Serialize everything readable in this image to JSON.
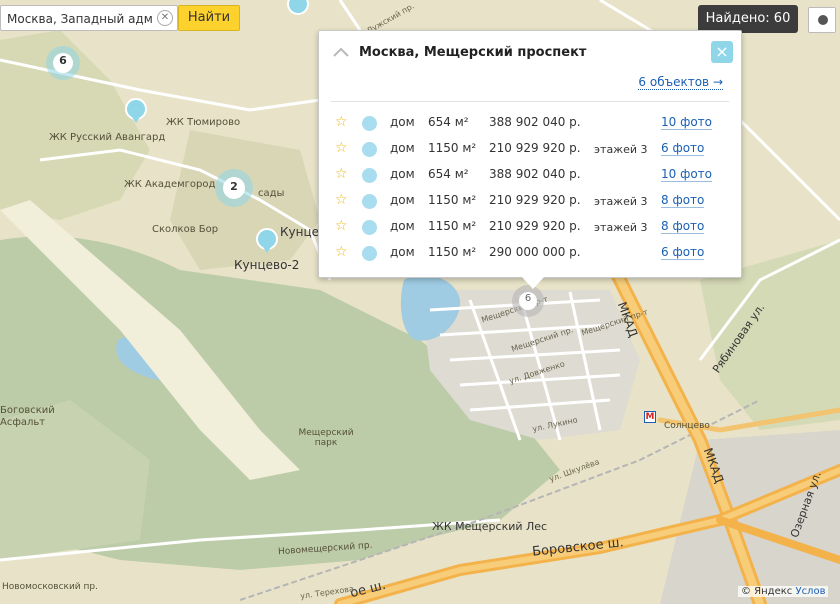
{
  "search": {
    "value": "Москва, Западный адм",
    "clear_icon": "close-icon",
    "button_label": "Найти"
  },
  "found_badge": "Найдено: 60",
  "popup": {
    "title": "Москва, Мещерский проспект",
    "objects_link": "6 объектов →",
    "rows": [
      {
        "type": "дом",
        "area": "654 м²",
        "price": "388 902 040 р.",
        "floors": "",
        "photos": "10 фото"
      },
      {
        "type": "дом",
        "area": "1150 м²",
        "price": "210 929 920 р.",
        "floors": "этажей 3",
        "photos": "6 фото"
      },
      {
        "type": "дом",
        "area": "654 м²",
        "price": "388 902 040 р.",
        "floors": "",
        "photos": "10 фото"
      },
      {
        "type": "дом",
        "area": "1150 м²",
        "price": "210 929 920 р.",
        "floors": "этажей 3",
        "photos": "8 фото"
      },
      {
        "type": "дом",
        "area": "1150 м²",
        "price": "210 929 920 р.",
        "floors": "этажей 3",
        "photos": "8 фото"
      },
      {
        "type": "дом",
        "area": "1150 м²",
        "price": "290 000 000 р.",
        "floors": "",
        "photos": "6 фото"
      }
    ]
  },
  "markers": [
    {
      "label": "6"
    },
    {
      "label": "2"
    },
    {
      "label": "6"
    }
  ],
  "map_labels": {
    "zhk_tyumirovo": "ЖК Тюмирово",
    "zhk_russky_avangard": "ЖК Русский Авангард",
    "zhk_akademmgorod": "ЖК Академгород",
    "sady": "сады",
    "skolkov_bor": "Сколков Бор",
    "kuntsevo": "Кунцево",
    "kuntsevo2": "Кунцево-2",
    "mkad_top": "МКАД",
    "mkad_bottom": "МКАД",
    "ryabinovaya": "Рябиновая ул.",
    "ozernaya": "Озерная ул.",
    "borovskoe": "Боровское ш.",
    "borovskoe_left": "ое ш.",
    "meshchersky_park": "Мещерский парк",
    "zhk_meshchersky_les": "ЖК Мещерский Лес",
    "novomeshchersky": "Новомещерский пр.",
    "novomosky": "Новомосковский пр.",
    "solntsevo": "Солнцево",
    "bogovsky": "Боговский\nАсфальт",
    "luzhsky": "Лужский пр.",
    "street_a": "Мещерский пр-т",
    "street_b": "Мещерский пр.",
    "street_c": "ул. Довженко",
    "street_d": "ул. Лукино",
    "street_e": "Мещерский пр-т",
    "street_f": "ул. Терехова",
    "street_g": "ул. Шкулёва"
  },
  "copyright": {
    "prefix": "© Яндекс",
    "link": "Услов"
  },
  "colors": {
    "land": "#e8e3c8",
    "park": "#b7c9a0",
    "water": "#9fcbe3",
    "major_road": "#f3b24a",
    "road": "#ffffff",
    "marker": "#8fd6e8",
    "star": "#e8b620",
    "link": "#1a5fb4",
    "find_button": "#fdd22d"
  }
}
